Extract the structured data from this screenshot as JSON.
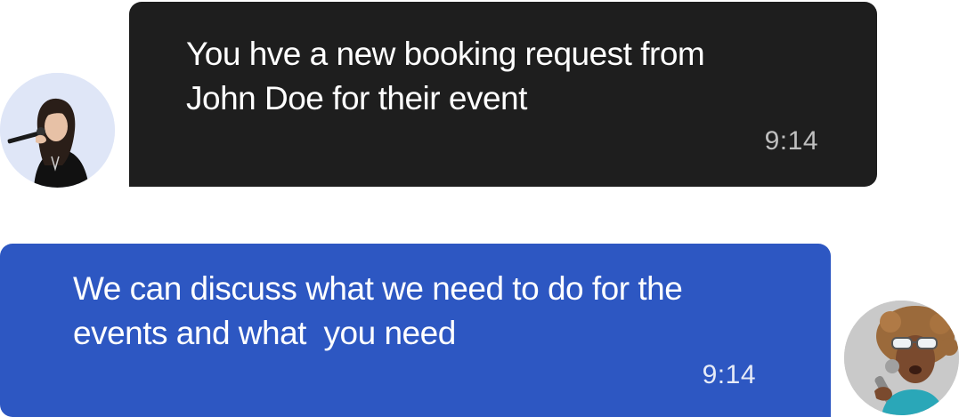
{
  "messages": [
    {
      "direction": "incoming",
      "text": "You hve a new booking request from\nJohn Doe for their event",
      "time": "9:14",
      "bubble_color": "#1e1e1e",
      "avatar_icon": "singer-avatar-icon"
    },
    {
      "direction": "outgoing",
      "text": "We can discuss what we need to do for the\nevents and what  you need",
      "time": "9:14",
      "bubble_color": "#2d57c2",
      "avatar_icon": "singer-avatar-icon"
    }
  ]
}
